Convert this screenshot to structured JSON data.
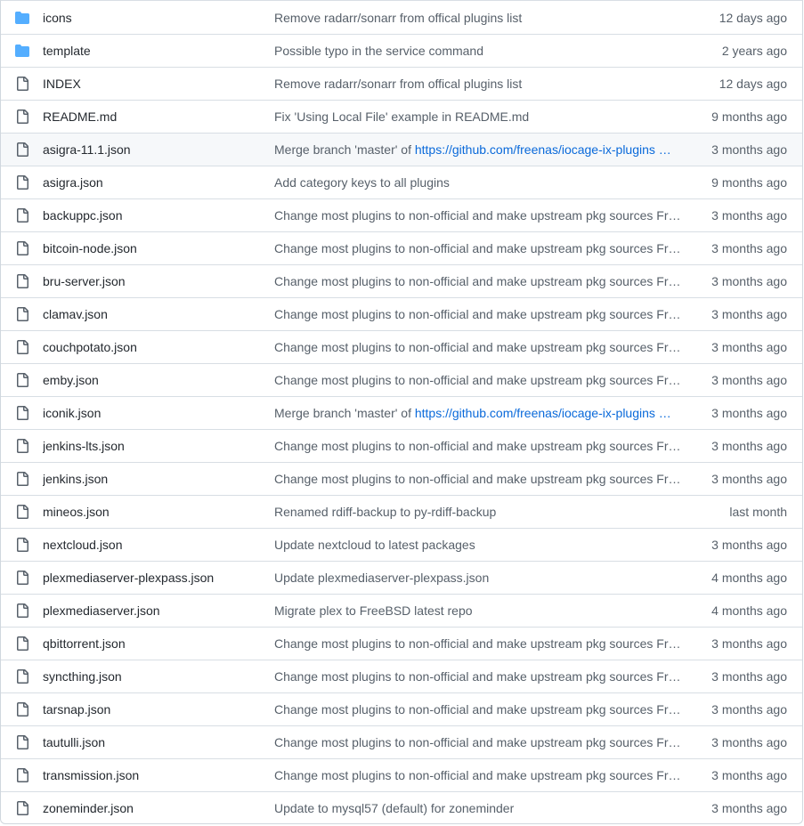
{
  "colors": {
    "folder_icon": "#54aeff",
    "file_icon": "#57606a",
    "link": "#0969da",
    "border": "#d8dee4",
    "hover_row": "#f6f8fa"
  },
  "rows": [
    {
      "type": "folder",
      "icon": "folder-icon",
      "name": "icons",
      "message": "Remove radarr/sonarr from offical plugins list",
      "age": "12 days ago"
    },
    {
      "type": "folder",
      "icon": "folder-icon",
      "name": "template",
      "message": "Possible typo in the service command",
      "age": "2 years ago"
    },
    {
      "type": "file",
      "icon": "file-icon",
      "name": "INDEX",
      "message": "Remove radarr/sonarr from offical plugins list",
      "age": "12 days ago"
    },
    {
      "type": "file",
      "icon": "file-icon",
      "name": "README.md",
      "message": "Fix 'Using Local File' example in README.md",
      "age": "9 months ago"
    },
    {
      "type": "file",
      "icon": "file-icon",
      "name": "asigra-11.1.json",
      "message": "Merge branch 'master' of ",
      "link": "https://github.com/freenas/iocage-ix-plugins …",
      "age": "3 months ago",
      "hover": true
    },
    {
      "type": "file",
      "icon": "file-icon",
      "name": "asigra.json",
      "message": "Add category keys to all plugins",
      "age": "9 months ago"
    },
    {
      "type": "file",
      "icon": "file-icon",
      "name": "backuppc.json",
      "message": "Change most plugins to non-official and make upstream pkg sources Fre…",
      "age": "3 months ago"
    },
    {
      "type": "file",
      "icon": "file-icon",
      "name": "bitcoin-node.json",
      "message": "Change most plugins to non-official and make upstream pkg sources Fre…",
      "age": "3 months ago"
    },
    {
      "type": "file",
      "icon": "file-icon",
      "name": "bru-server.json",
      "message": "Change most plugins to non-official and make upstream pkg sources Fre…",
      "age": "3 months ago"
    },
    {
      "type": "file",
      "icon": "file-icon",
      "name": "clamav.json",
      "message": "Change most plugins to non-official and make upstream pkg sources Fre…",
      "age": "3 months ago"
    },
    {
      "type": "file",
      "icon": "file-icon",
      "name": "couchpotato.json",
      "message": "Change most plugins to non-official and make upstream pkg sources Fre…",
      "age": "3 months ago"
    },
    {
      "type": "file",
      "icon": "file-icon",
      "name": "emby.json",
      "message": "Change most plugins to non-official and make upstream pkg sources Fre…",
      "age": "3 months ago"
    },
    {
      "type": "file",
      "icon": "file-icon",
      "name": "iconik.json",
      "message": "Merge branch 'master' of ",
      "link": "https://github.com/freenas/iocage-ix-plugins …",
      "age": "3 months ago"
    },
    {
      "type": "file",
      "icon": "file-icon",
      "name": "jenkins-lts.json",
      "message": "Change most plugins to non-official and make upstream pkg sources Fre…",
      "age": "3 months ago"
    },
    {
      "type": "file",
      "icon": "file-icon",
      "name": "jenkins.json",
      "message": "Change most plugins to non-official and make upstream pkg sources Fre…",
      "age": "3 months ago"
    },
    {
      "type": "file",
      "icon": "file-icon",
      "name": "mineos.json",
      "message": "Renamed rdiff-backup to py-rdiff-backup",
      "age": "last month"
    },
    {
      "type": "file",
      "icon": "file-icon",
      "name": "nextcloud.json",
      "message": "Update nextcloud to latest packages",
      "age": "3 months ago"
    },
    {
      "type": "file",
      "icon": "file-icon",
      "name": "plexmediaserver-plexpass.json",
      "message": "Update plexmediaserver-plexpass.json",
      "age": "4 months ago"
    },
    {
      "type": "file",
      "icon": "file-icon",
      "name": "plexmediaserver.json",
      "message": "Migrate plex to FreeBSD latest repo",
      "age": "4 months ago"
    },
    {
      "type": "file",
      "icon": "file-icon",
      "name": "qbittorrent.json",
      "message": "Change most plugins to non-official and make upstream pkg sources Fre…",
      "age": "3 months ago"
    },
    {
      "type": "file",
      "icon": "file-icon",
      "name": "syncthing.json",
      "message": "Change most plugins to non-official and make upstream pkg sources Fre…",
      "age": "3 months ago"
    },
    {
      "type": "file",
      "icon": "file-icon",
      "name": "tarsnap.json",
      "message": "Change most plugins to non-official and make upstream pkg sources Fre…",
      "age": "3 months ago"
    },
    {
      "type": "file",
      "icon": "file-icon",
      "name": "tautulli.json",
      "message": "Change most plugins to non-official and make upstream pkg sources Fre…",
      "age": "3 months ago"
    },
    {
      "type": "file",
      "icon": "file-icon",
      "name": "transmission.json",
      "message": "Change most plugins to non-official and make upstream pkg sources Fre…",
      "age": "3 months ago"
    },
    {
      "type": "file",
      "icon": "file-icon",
      "name": "zoneminder.json",
      "message": "Update to mysql57 (default) for zoneminder",
      "age": "3 months ago"
    }
  ]
}
